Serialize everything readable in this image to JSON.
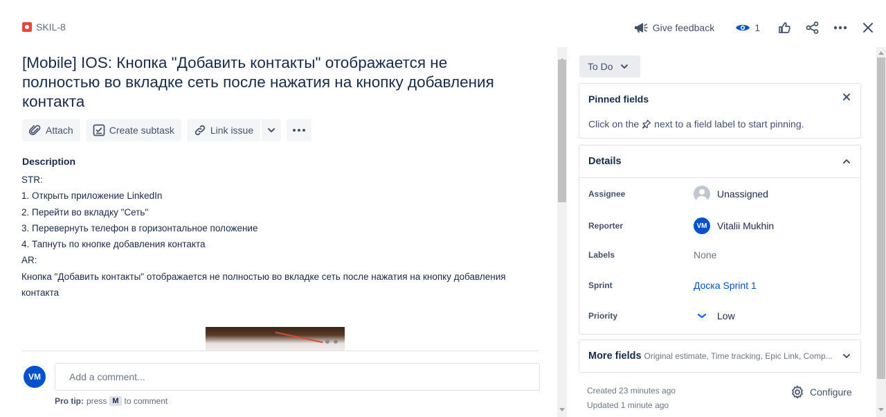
{
  "issue": {
    "key": "SKIL-8",
    "title": "[Mobile] IOS: Кнопка \"Добавить контакты\" отображается не полностью во вкладке сеть после нажатия на кнопку добавления контакта"
  },
  "header": {
    "feedback_label": "Give feedback",
    "watch_count": "1"
  },
  "toolbar": {
    "attach_label": "Attach",
    "subtask_label": "Create subtask",
    "link_label": "Link issue"
  },
  "description": {
    "label": "Description",
    "lines": [
      "STR:",
      "1.  Открыть приложение LinkedIn",
      "2. Перейти во вкладку \"Сеть\"",
      "3. Перевернуть телефон в горизонтальное положение",
      "4. Тапнуть по кнопке добавления контакта",
      "AR:",
      "Кнопка \"Добавить контакты\" отображается не полностью во вкладке сеть после нажатия на кнопку добавления контакта"
    ]
  },
  "comment": {
    "avatar_initials": "VM",
    "placeholder": "Add a comment...",
    "pro_tip_label": "Pro tip:",
    "pro_tip_press": "press",
    "pro_tip_key": "M",
    "pro_tip_suffix": "to comment"
  },
  "status": {
    "label": "To Do"
  },
  "pinned": {
    "title": "Pinned fields",
    "hint_before": "Click on the",
    "hint_after": "next to a field label to start pinning."
  },
  "details": {
    "title": "Details",
    "fields": {
      "assignee": {
        "label": "Assignee",
        "value": "Unassigned"
      },
      "reporter": {
        "label": "Reporter",
        "value": "Vitalii Mukhin",
        "initials": "VM"
      },
      "labels": {
        "label": "Labels",
        "value": "None"
      },
      "sprint": {
        "label": "Sprint",
        "value": "Доска Sprint 1"
      },
      "priority": {
        "label": "Priority",
        "value": "Low"
      }
    }
  },
  "more_fields": {
    "title": "More fields",
    "subtitle": "Original estimate, Time tracking, Epic Link, Comp..."
  },
  "meta": {
    "created": "Created 23 minutes ago",
    "updated": "Updated 1 minute ago",
    "configure_label": "Configure"
  },
  "colors": {
    "brand_blue": "#0052cc",
    "bug_red": "#e5493a",
    "text_primary": "#172b4d",
    "text_subtle": "#42526e"
  }
}
